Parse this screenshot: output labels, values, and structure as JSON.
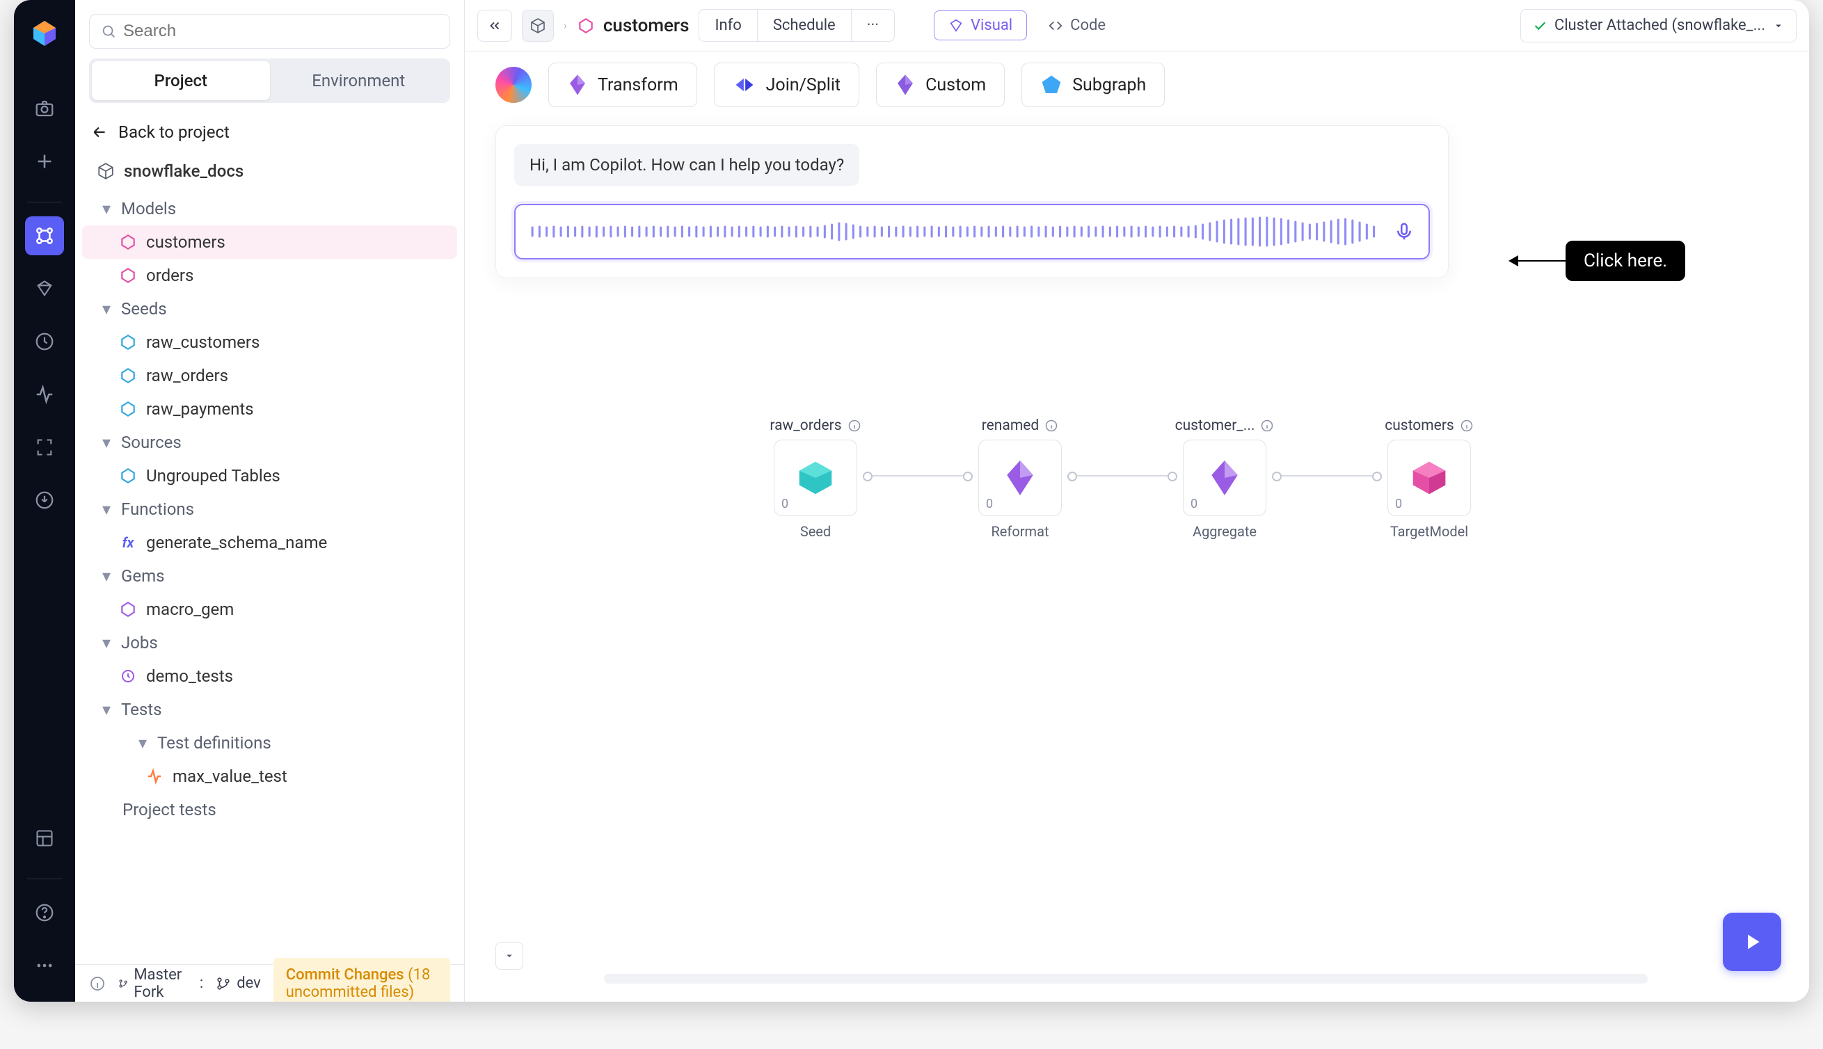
{
  "search": {
    "placeholder": "Search"
  },
  "tabs": {
    "project": "Project",
    "environment": "Environment"
  },
  "back_label": "Back to project",
  "project_name": "snowflake_docs",
  "sections": {
    "models": "Models",
    "seeds": "Seeds",
    "sources": "Sources",
    "functions": "Functions",
    "gems": "Gems",
    "jobs": "Jobs",
    "tests": "Tests",
    "test_definitions": "Test definitions",
    "project_tests": "Project tests"
  },
  "items": {
    "customers": "customers",
    "orders": "orders",
    "raw_customers": "raw_customers",
    "raw_orders": "raw_orders",
    "raw_payments": "raw_payments",
    "ungrouped_tables": "Ungrouped Tables",
    "generate_schema_name": "generate_schema_name",
    "macro_gem": "macro_gem",
    "demo_tests": "demo_tests",
    "max_value_test": "max_value_test"
  },
  "breadcrumb": {
    "current": "customers"
  },
  "topbar": {
    "info": "Info",
    "schedule": "Schedule",
    "visual": "Visual",
    "code": "Code",
    "cluster": "Cluster Attached (snowflake_..."
  },
  "gems": {
    "transform": "Transform",
    "joinsplit": "Join/Split",
    "custom": "Custom",
    "subgraph": "Subgraph"
  },
  "copilot": {
    "greeting": "Hi, I am Copilot. How can I help you today?"
  },
  "callout": "Click here.",
  "graph": {
    "n1": {
      "title": "raw_orders",
      "sub": "Seed",
      "zero": "0"
    },
    "n2": {
      "title": "renamed",
      "sub": "Reformat",
      "zero": "0"
    },
    "n3": {
      "title": "customer_...",
      "sub": "Aggregate",
      "zero": "0"
    },
    "n4": {
      "title": "customers",
      "sub": "TargetModel",
      "zero": "0"
    }
  },
  "footer": {
    "master": "Master Fork",
    "colon": ":",
    "dev": "dev",
    "commit": "Commit Changes ",
    "commit_count": "(18 uncommitted files)"
  }
}
